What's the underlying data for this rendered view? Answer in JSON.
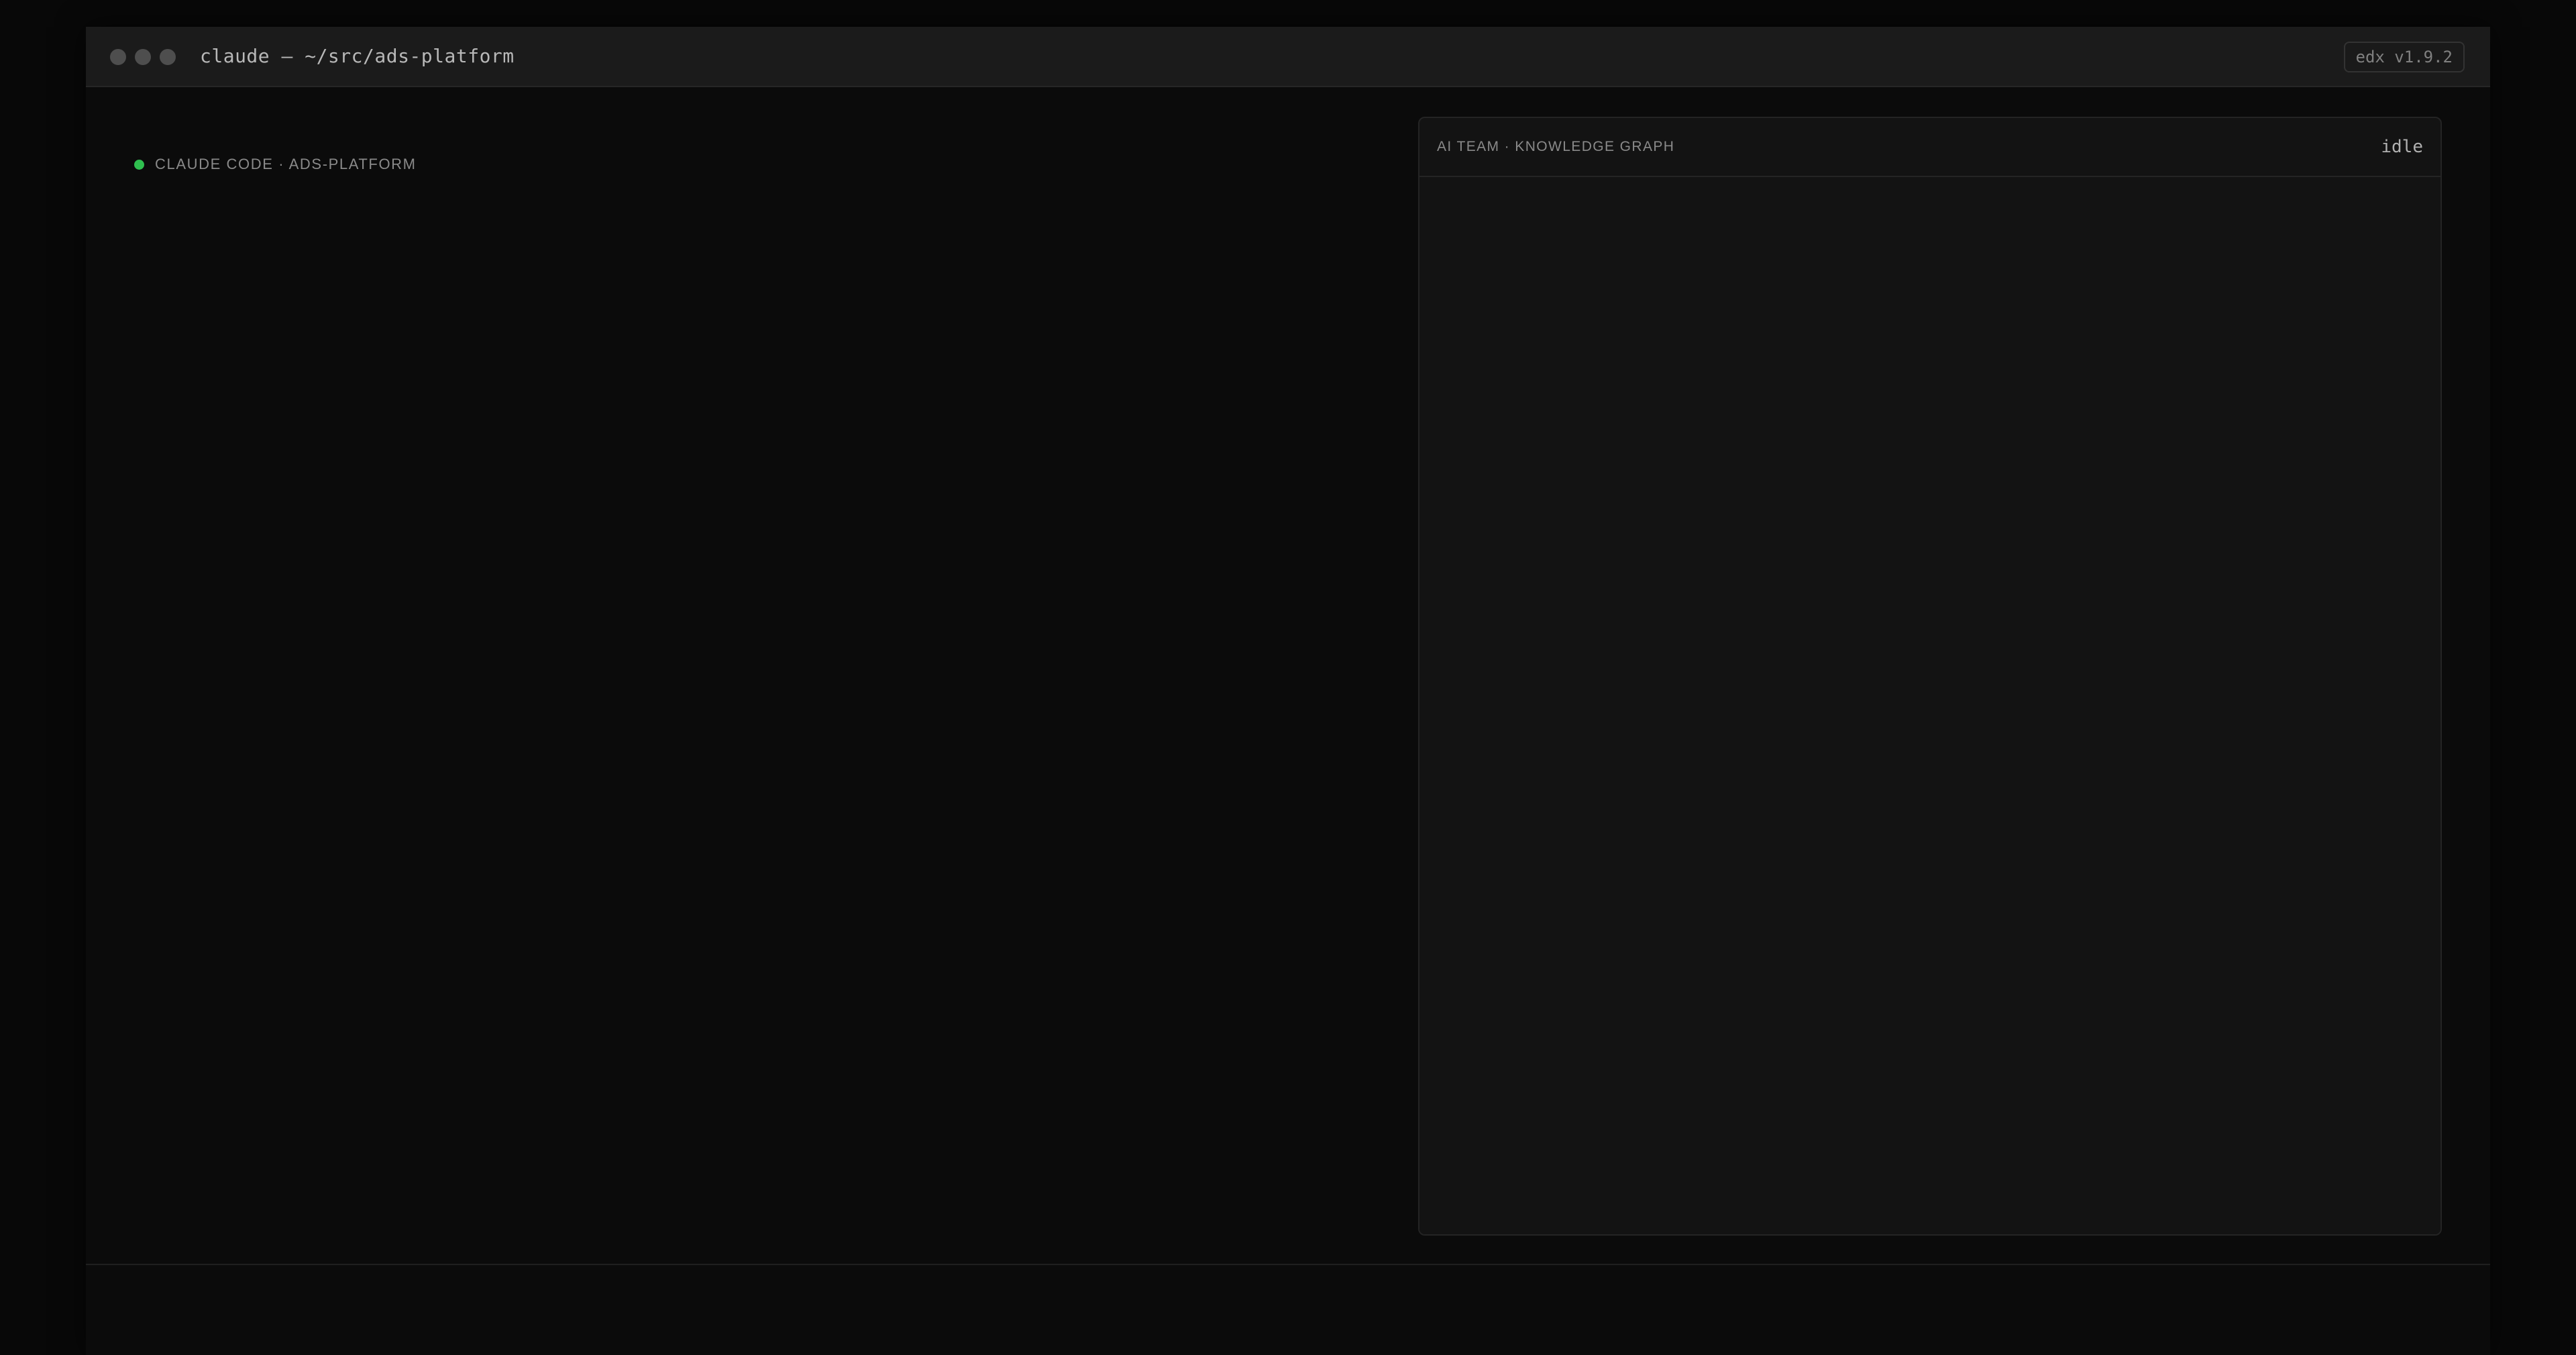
{
  "window": {
    "title": "claude — ~/src/ads-platform",
    "version_badge": "edx v1.9.2"
  },
  "session": {
    "label": "CLAUDE CODE · ADS-PLATFORM",
    "status_color": "#2fbf4f"
  },
  "panel": {
    "title": "AI TEAM · KNOWLEDGE GRAPH",
    "status": "idle"
  },
  "icons": {
    "traffic_lights": [
      "close-button-icon",
      "minimize-button-icon",
      "zoom-button-icon"
    ],
    "status_dot": "status-dot-icon"
  }
}
